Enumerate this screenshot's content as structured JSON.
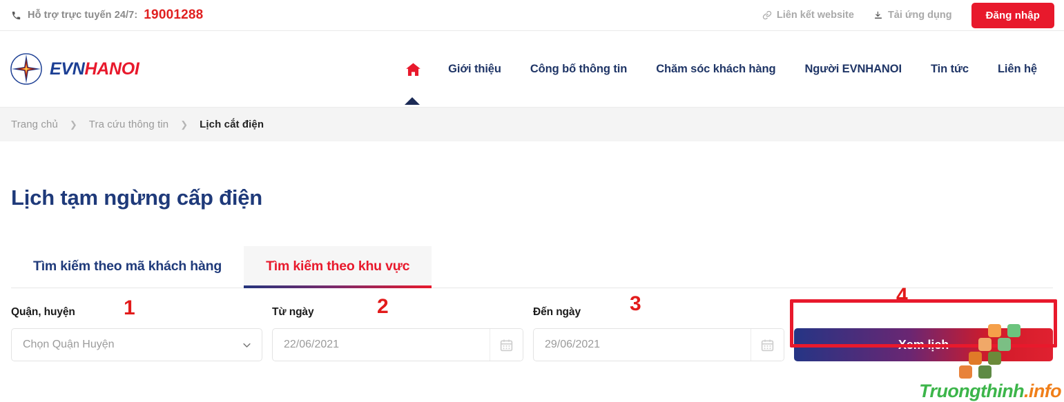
{
  "topbar": {
    "phone_icon": "phone-icon",
    "hotline_label": "Hỗ trợ trực tuyến 24/7:",
    "hotline_number": "19001288",
    "links": [
      {
        "icon": "link-icon",
        "label": "Liên kết website"
      },
      {
        "icon": "download-icon",
        "label": "Tải ứng dụng"
      }
    ],
    "login_label": "Đăng nhập",
    "login_color": "#e8192c"
  },
  "header": {
    "logo": {
      "icon": "evn-star-logo-icon",
      "text_primary": "EVN",
      "text_secondary": "HANOI"
    },
    "nav": [
      {
        "name": "home",
        "icon": "home-icon",
        "label": "",
        "active": true
      },
      {
        "name": "gioi-thieu",
        "label": "Giới thiệu",
        "active": false
      },
      {
        "name": "cong-bo-thong-tin",
        "label": "Công bố thông tin",
        "active": false
      },
      {
        "name": "cham-soc-khach-hang",
        "label": "Chăm sóc khách hàng",
        "active": false
      },
      {
        "name": "nguoi-evnhanoi",
        "label": "Người EVNHANOI",
        "active": false
      },
      {
        "name": "tin-tuc",
        "label": "Tin tức",
        "active": false
      },
      {
        "name": "lien-he",
        "label": "Liên hệ",
        "active": false
      }
    ],
    "nav_color": "#1f3566"
  },
  "breadcrumb": {
    "separator": "❯",
    "items": [
      {
        "label": "Trang chủ",
        "current": false
      },
      {
        "label": "Tra cứu thông tin",
        "current": false
      },
      {
        "label": "Lịch cắt điện",
        "current": true
      }
    ]
  },
  "main": {
    "page_title": "Lịch tạm ngừng cấp điện",
    "title_color": "#1f3a7a",
    "tabs": [
      {
        "label": "Tìm kiếm theo mã khách hàng",
        "active": false
      },
      {
        "label": "Tìm kiếm theo khu vực",
        "active": true
      }
    ],
    "tab_active_color": "#e8192c",
    "form": {
      "district": {
        "label": "Quận, huyện",
        "placeholder": "Chọn Quận Huyện",
        "value": "",
        "step": "1",
        "chevron_icon": "chevron-down-icon"
      },
      "from_date": {
        "label": "Từ ngày",
        "placeholder": "22/06/2021",
        "value": "22/06/2021",
        "step": "2",
        "calendar_icon": "calendar-icon"
      },
      "to_date": {
        "label": "Đến ngày",
        "placeholder": "29/06/2021",
        "value": "29/06/2021",
        "step": "3",
        "calendar_icon": "calendar-icon"
      },
      "submit": {
        "label": "Xem lịch",
        "step": "4",
        "highlighted": true,
        "highlight_color": "#e8192c"
      }
    }
  },
  "watermark": {
    "text_primary": "Truongthinh",
    "text_secondary": ".info",
    "color_primary": "#3cb54a",
    "color_secondary": "#f07f1a"
  }
}
